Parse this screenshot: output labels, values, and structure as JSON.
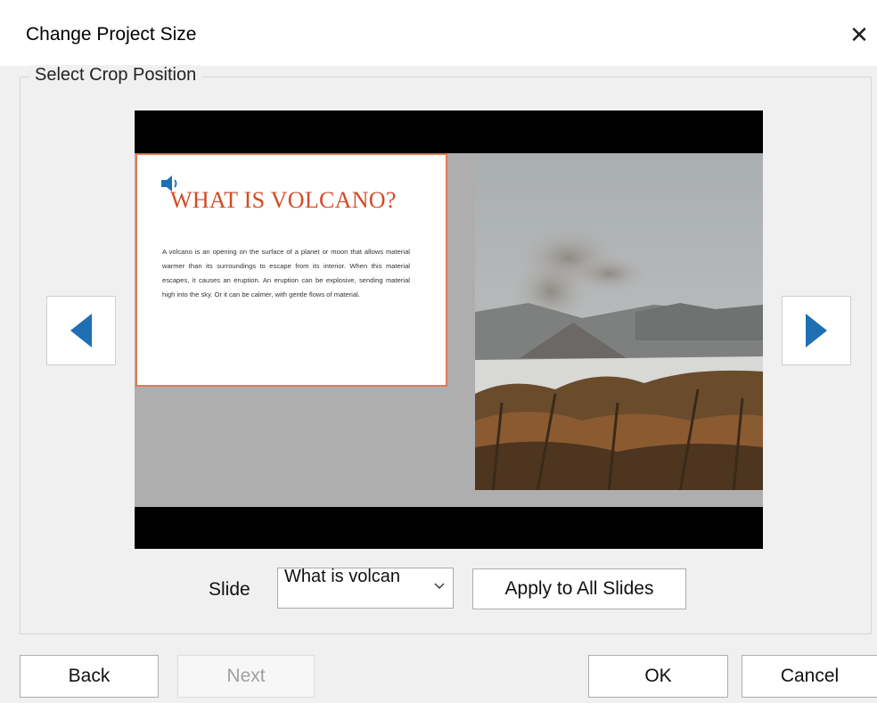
{
  "dialog": {
    "title": "Change Project Size",
    "close_symbol": "✕"
  },
  "crop": {
    "legend": "Select Crop Position"
  },
  "slide_preview": {
    "heading": "WHAT IS VOLCANO?",
    "body": "A volcano is an opening on the surface of a planet or moon that allows material warmer than its surroundings to escape from its interior. When this material escapes, it causes an eruption. An eruption can be explosive, sending material high into the sky. Or it can be calmer, with gentle flows of material.",
    "speaker_icon": "speaker-icon",
    "accent_color": "#d24a26",
    "card_border_color": "#e07a55"
  },
  "navigation": {
    "prev_icon": "triangle-left-icon",
    "next_icon": "triangle-right-icon",
    "arrow_color": "#1f6fb5"
  },
  "slide_selector": {
    "label": "Slide",
    "selected_value": "What is volcan"
  },
  "buttons": {
    "apply_all": "Apply to All Slides",
    "back": "Back",
    "next": "Next",
    "ok": "OK",
    "cancel": "Cancel"
  }
}
